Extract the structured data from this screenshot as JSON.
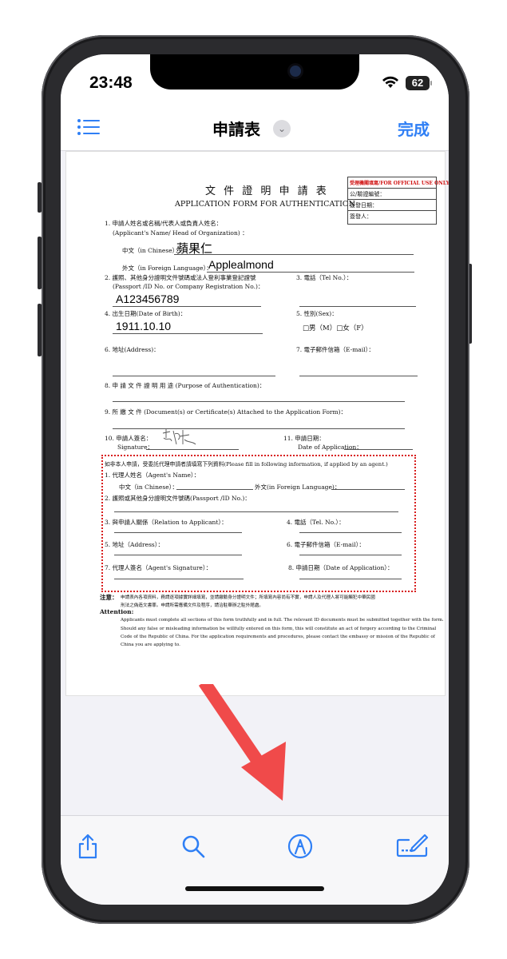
{
  "status_bar": {
    "time": "23:48",
    "battery": "62"
  },
  "nav": {
    "title": "申請表",
    "done_label": "完成",
    "list_icon": "list-icon",
    "chevron_icon": "chevron-down-icon"
  },
  "form": {
    "title_zh": "文 件 證 明 申 請 表",
    "title_en": "APPLICATION FORM FOR AUTHENTICATION",
    "official_box": {
      "header": "受理機關填寫/FOR OFFICIAL USE ONLY",
      "row1": "公/驗證編號：",
      "row2": "簽發日期：",
      "row3": "簽發人："
    },
    "f1_label": "1. 申請人姓名或名稱/代表人或負責人姓名：",
    "f1_label_en": "(Applicant's Name/ Head of Organization) ：",
    "chinese_name_label": "中文（in Chinese）：",
    "chinese_name_value": "蘋果仁",
    "foreign_name_label": "外文（in Foreign Language）：",
    "foreign_name_value": "Applealmond",
    "f2_label": "2. 護照、其他身分證明文件號碼或法人登利事業登記證號",
    "f2_label_en": "(Passport /ID No. or Company Registration No.)：",
    "f2_value": "A123456789",
    "f3_label": "3. 電話（Tel No.）：",
    "f4_label": "4. 出生日期(Date of Birth)：",
    "f4_value": "1911.10.10",
    "f5_label": "5. 性別(Sex)：",
    "f5_options": "□男（M）□女（F）",
    "f6_label": "6. 地址(Address)：",
    "f7_label": "7. 電子郵件信箱（E-mail）：",
    "f8_label": "8. 申 請 文 件 證 明 用 途 (Purpose of Authentication)：",
    "f9_label": "9. 所 繳 文 件 (Document(s) or Certificate(s) Attached to the Application Form)：",
    "f10_label": "10. 申請人簽名：",
    "f10_label_en": "Signature：",
    "f11_label": "11. 申請日期：",
    "f11_label_en": "Date of Application：",
    "agent_intro": "如非本人申請，受委託代理申請者請填寫下列資料(Please fill in following information, if applied by an agent.)",
    "a1_label": "1. 代理人姓名（Agent's Name）：",
    "a1_chinese": "中文（in Chinese）：",
    "a1_foreign": "外文(in Foreign Language)：",
    "a2_label": "2. 護照或其他身分證明文件號碼(Passport /ID No.)：",
    "a3_label": "3. 與申請人關係（Relation to Applicant）：",
    "a4_label": "4. 電話（Tel. No.）：",
    "a5_label": "5. 地址（Address）：",
    "a6_label": "6. 電子郵件信箱（E-mail）：",
    "a7_label": "7. 代理人簽名（Agent's Signature）：",
    "a8_label": "8. 申請日期（Date of Application）：",
    "note_label": "注意：",
    "note_zh1": "申請表內各項資料，務請逐項據實詳細填寫，並請繳驗身分證明文件；所填寫內容尚有不實，申請人及代理人將可能觸犯中華民國",
    "note_zh2": "刑法之偽造文書罪。申請所需應備文件及程序，請洽駐華辦之駐外館處。",
    "attention_label": "Attention:",
    "attention_1": "Applicants must complete all sections of this form truthfully and in full. The relevant ID documents must be submitted together with the form.",
    "attention_2": "Should any false or misleading information be willfully entered on this form, this will constitute an act of forgery according to the Criminal",
    "attention_3": "Code of the Republic of China.   For the application requirements and procedures, please contact the embassy or mission of the Republic of",
    "attention_4": "China you are applying to."
  },
  "toolbar": {
    "share_icon": "share-icon",
    "search_icon": "search-icon",
    "markup_icon": "markup-pen-icon",
    "signature_icon": "signature-icon"
  },
  "colors": {
    "accent": "#2f7ff5",
    "arrow": "#f04a4a",
    "dotted_border": "#d81e1e"
  }
}
